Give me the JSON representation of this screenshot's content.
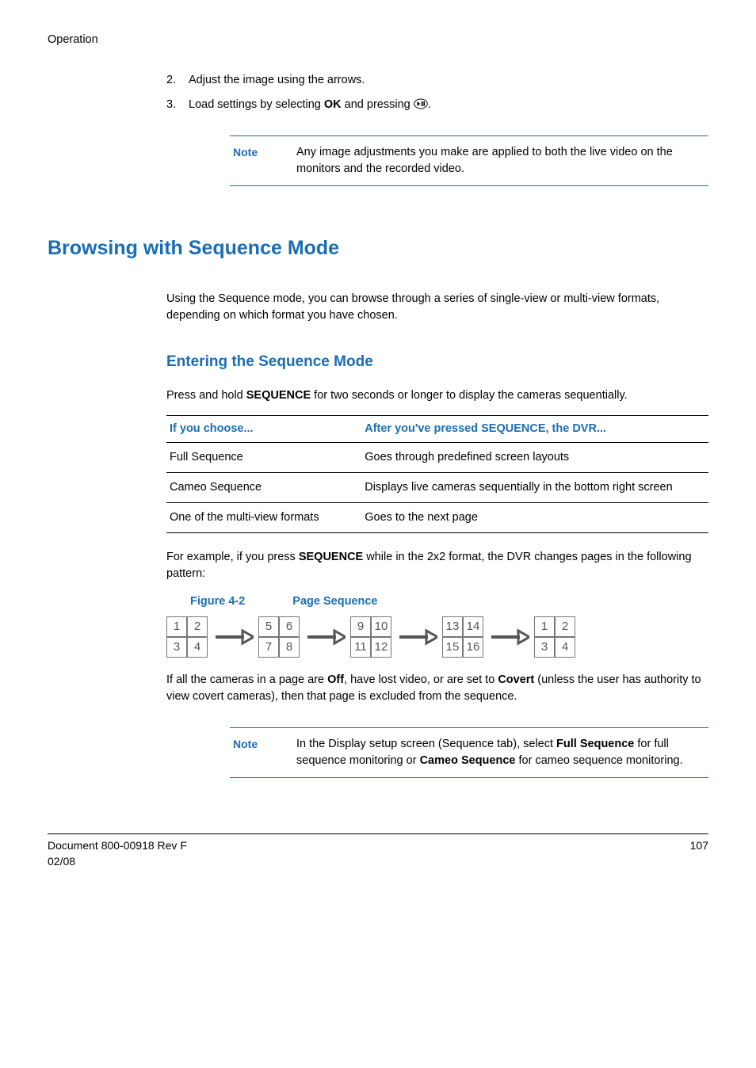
{
  "running_head": "Operation",
  "steps": [
    {
      "num": "2.",
      "text": "Adjust the image using the arrows."
    },
    {
      "num": "3.",
      "pre": "Load settings by selecting ",
      "bold": "OK",
      "post": " and pressing ",
      "tail": "."
    }
  ],
  "note1": {
    "label": "Note",
    "text": "Any image adjustments you make are applied to both the live video on the monitors and the recorded video."
  },
  "h1": "Browsing with Sequence Mode",
  "intro": "Using the Sequence mode, you can browse through a series of single-view or multi-view formats, depending on which format you have chosen.",
  "h2": "Entering the Sequence Mode",
  "enter_para_pre": "Press and hold ",
  "enter_para_bold": "SEQUENCE",
  "enter_para_post": " for two seconds or longer to display the cameras sequentially.",
  "table": {
    "col1": "If you choose...",
    "col2": "After you've pressed SEQUENCE, the DVR...",
    "rows": [
      {
        "c1": "Full Sequence",
        "c2": "Goes through predefined screen layouts"
      },
      {
        "c1": "Cameo Sequence",
        "c2": "Displays live cameras sequentially in the bottom right screen"
      },
      {
        "c1": "One of the multi-view formats",
        "c2": "Goes to the next page"
      }
    ]
  },
  "example_pre": "For example, if you press ",
  "example_bold": "SEQUENCE",
  "example_post": " while in the 2x2 format, the DVR changes pages in the following pattern:",
  "figure": {
    "num": "Figure 4-2",
    "title": "Page Sequence"
  },
  "grids": [
    [
      "1",
      "2",
      "3",
      "4"
    ],
    [
      "5",
      "6",
      "7",
      "8"
    ],
    [
      "9",
      "10",
      "11",
      "12"
    ],
    [
      "13",
      "14",
      "15",
      "16"
    ],
    [
      "1",
      "2",
      "3",
      "4"
    ]
  ],
  "off_para": {
    "p1": "If all the cameras in a page are ",
    "b1": "Off",
    "p2": ", have lost video, or are set to ",
    "b2": "Covert",
    "p3": " (unless the user has authority to view covert cameras), then that page is excluded from the sequence."
  },
  "note2": {
    "label": "Note",
    "p1": "In the Display setup screen (Sequence tab), select ",
    "b1": "Full Sequence",
    "p2": " for full sequence monitoring or ",
    "b2": "Cameo Sequence",
    "p3": " for cameo sequence monitoring."
  },
  "footer": {
    "left1": "Document 800-00918 Rev F",
    "left2": "02/08",
    "right": "107"
  }
}
